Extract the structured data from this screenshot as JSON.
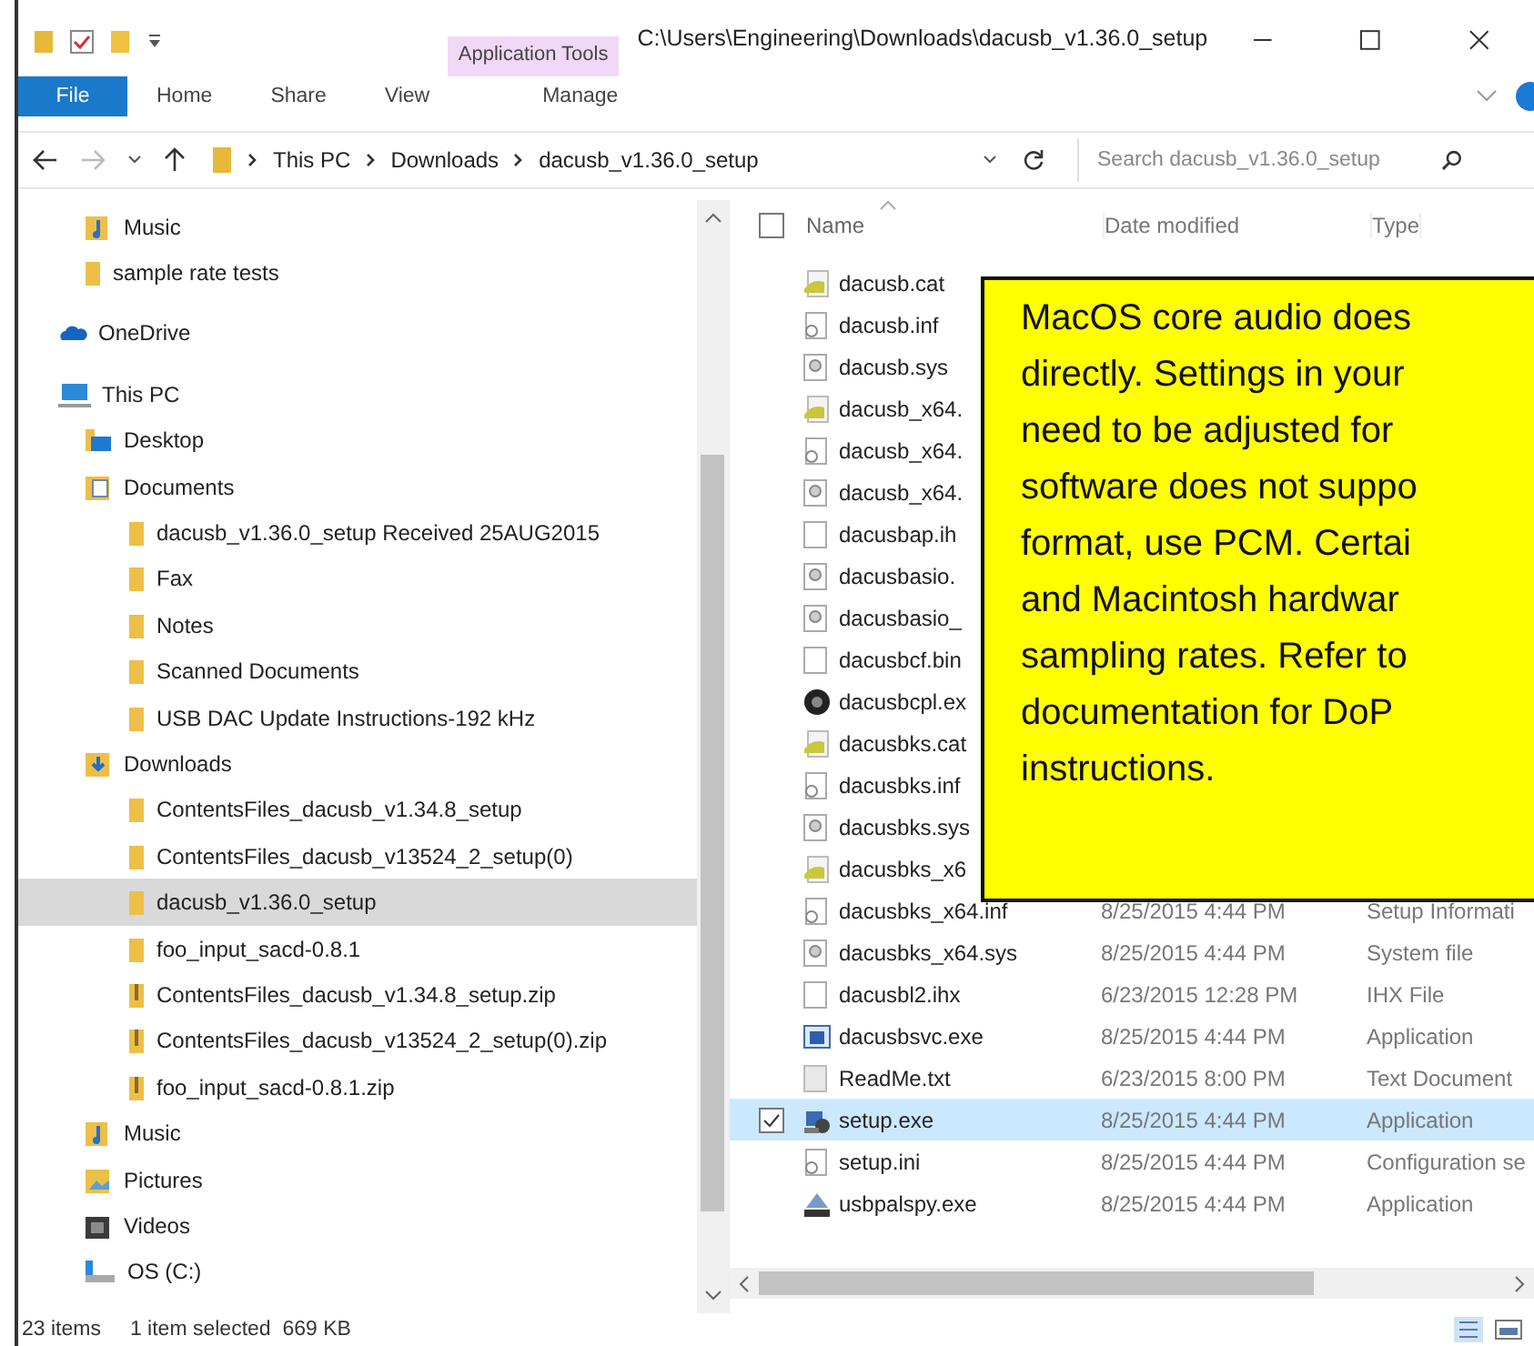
{
  "window": {
    "title": "C:\\Users\\Engineering\\Downloads\\dacusb_v1.36.0_setup",
    "context_tab": "Application Tools"
  },
  "ribbon_tabs": [
    {
      "label": "File",
      "kind": "menu"
    },
    {
      "label": "Home",
      "kind": "tab"
    },
    {
      "label": "Share",
      "kind": "tab"
    },
    {
      "label": "View",
      "kind": "tab"
    },
    {
      "label": "Manage",
      "kind": "tab"
    }
  ],
  "address": {
    "crumbs": [
      "This PC",
      "Downloads",
      "dacusb_v1.36.0_setup"
    ]
  },
  "search": {
    "placeholder": "Search dacusb_v1.36.0_setup"
  },
  "nav": {
    "continued_items": [
      {
        "label": "Music",
        "kind": "music",
        "selected": false
      },
      {
        "label": "sample rate tests",
        "kind": "folder",
        "selected": false
      }
    ],
    "items": [
      {
        "label": "OneDrive",
        "kind": "onedrive",
        "selected": false
      },
      {
        "label": "This PC",
        "kind": "pc",
        "selected": false,
        "children": [
          {
            "label": "Desktop",
            "kind": "desktop",
            "selected": false
          },
          {
            "label": "Documents",
            "kind": "documents",
            "selected": false,
            "children": [
              {
                "label": "dacusb_v1.36.0_setup Received 25AUG2015",
                "kind": "folder",
                "selected": false
              },
              {
                "label": "Fax",
                "kind": "folder",
                "selected": false
              },
              {
                "label": "Notes",
                "kind": "folder",
                "selected": false
              },
              {
                "label": "Scanned Documents",
                "kind": "folder",
                "selected": false
              },
              {
                "label": "USB DAC Update Instructions-192 kHz",
                "kind": "folder",
                "selected": false
              }
            ]
          },
          {
            "label": "Downloads",
            "kind": "downloads",
            "selected": false,
            "children": [
              {
                "label": "ContentsFiles_dacusb_v1.34.8_setup",
                "kind": "folder",
                "selected": false
              },
              {
                "label": "ContentsFiles_dacusb_v13524_2_setup(0)",
                "kind": "folder",
                "selected": false
              },
              {
                "label": "dacusb_v1.36.0_setup",
                "kind": "folder",
                "selected": true
              },
              {
                "label": "foo_input_sacd-0.8.1",
                "kind": "folder",
                "selected": false
              },
              {
                "label": "ContentsFiles_dacusb_v1.34.8_setup.zip",
                "kind": "zip",
                "selected": false
              },
              {
                "label": "ContentsFiles_dacusb_v13524_2_setup(0).zip",
                "kind": "zip",
                "selected": false
              },
              {
                "label": "foo_input_sacd-0.8.1.zip",
                "kind": "zip",
                "selected": false
              }
            ]
          },
          {
            "label": "Music",
            "kind": "music",
            "selected": false
          },
          {
            "label": "Pictures",
            "kind": "pictures",
            "selected": false
          },
          {
            "label": "Videos",
            "kind": "videos",
            "selected": false
          },
          {
            "label": "OS (C:)",
            "kind": "drive",
            "selected": false
          }
        ]
      }
    ]
  },
  "files": {
    "columns": [
      "Name",
      "Date modified",
      "Type"
    ],
    "all_checked": false,
    "rows": [
      {
        "name": "dacusb.cat",
        "kind": "catalog",
        "selected": false
      },
      {
        "name": "dacusb.inf",
        "kind": "settings",
        "selected": false
      },
      {
        "name": "dacusb.sys",
        "kind": "system",
        "selected": false
      },
      {
        "name": "dacusb_x64.",
        "kind": "catalog",
        "selected": false
      },
      {
        "name": "dacusb_x64.",
        "kind": "settings",
        "selected": false
      },
      {
        "name": "dacusb_x64.",
        "kind": "system",
        "selected": false
      },
      {
        "name": "dacusbap.ih",
        "kind": "blank",
        "selected": false
      },
      {
        "name": "dacusbasio.",
        "kind": "system",
        "selected": false
      },
      {
        "name": "dacusbasio_",
        "kind": "system",
        "selected": false
      },
      {
        "name": "dacusbcf.bin",
        "kind": "blank",
        "selected": false
      },
      {
        "name": "dacusbcpl.ex",
        "kind": "cpl",
        "selected": false
      },
      {
        "name": "dacusbks.cat",
        "kind": "catalog",
        "selected": false
      },
      {
        "name": "dacusbks.inf",
        "kind": "settings",
        "selected": false
      },
      {
        "name": "dacusbks.sys",
        "kind": "system",
        "selected": false
      },
      {
        "name": "dacusbks_x6",
        "kind": "catalog",
        "selected": false
      },
      {
        "name": "dacusbks_x64.inf",
        "date": "8/25/2015 4:44 PM",
        "type": "Setup Informati",
        "kind": "settings",
        "selected": false
      },
      {
        "name": "dacusbks_x64.sys",
        "date": "8/25/2015 4:44 PM",
        "type": "System file",
        "kind": "system",
        "selected": false
      },
      {
        "name": "dacusbl2.ihx",
        "date": "6/23/2015 12:28 PM",
        "type": "IHX File",
        "kind": "blank",
        "selected": false
      },
      {
        "name": "dacusbsvc.exe",
        "date": "8/25/2015 4:44 PM",
        "type": "Application",
        "kind": "app",
        "selected": false
      },
      {
        "name": "ReadMe.txt",
        "date": "6/23/2015 8:00 PM",
        "type": "Text Document",
        "kind": "text",
        "selected": false
      },
      {
        "name": "setup.exe",
        "date": "8/25/2015 4:44 PM",
        "type": "Application",
        "kind": "installer",
        "selected": true
      },
      {
        "name": "setup.ini",
        "date": "8/25/2015 4:44 PM",
        "type": "Configuration se",
        "kind": "settings",
        "selected": false
      },
      {
        "name": "usbpalspy.exe",
        "date": "8/25/2015 4:44 PM",
        "type": "Application",
        "kind": "spy",
        "selected": false
      }
    ]
  },
  "status_bar": {
    "count": "23 items",
    "selection": "1 item selected  669 KB"
  },
  "callout": {
    "lines": [
      "MacOS core audio does",
      "directly. Settings in your",
      "need to be adjusted for",
      "software does not suppo",
      "format, use PCM. Certai",
      "and Macintosh hardwar",
      "sampling rates. Refer to",
      "documentation for DoP",
      "instructions."
    ]
  }
}
